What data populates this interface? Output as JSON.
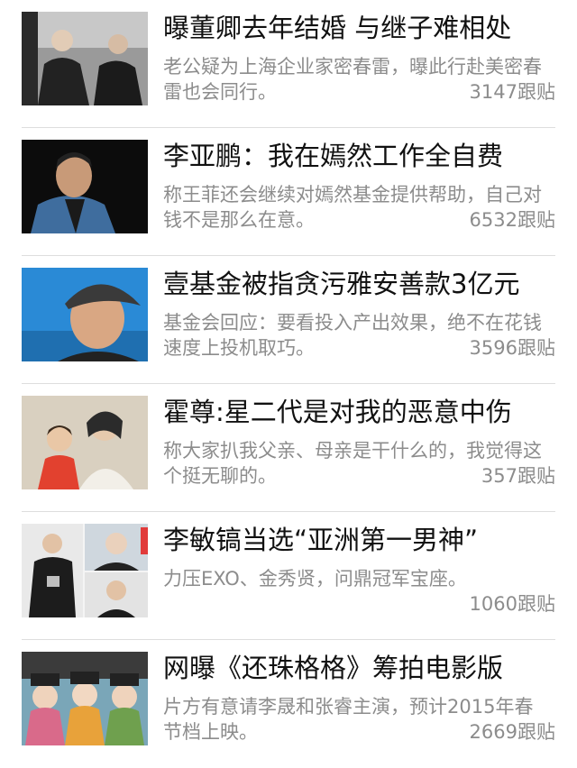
{
  "news": [
    {
      "title": "曝董卿去年结婚 与继子难相处",
      "summary": "老公疑为上海企业家密春雷，曝此行赴美密春雷也会同行。",
      "comments": "3147跟贴",
      "image_subject": "couple-walking-photo"
    },
    {
      "title": "李亚鹏：我在嫣然工作全自费",
      "summary": "称王菲还会继续对嫣然基金提供帮助，自己对钱不是那么在意。",
      "comments": "6532跟贴",
      "image_subject": "man-portrait-photo"
    },
    {
      "title": "壹基金被指贪污雅安善款3亿元",
      "summary": "基金会回应：要看投入产出效果，绝不在花钱速度上投机取巧。",
      "comments": "3596跟贴",
      "image_subject": "man-in-cap-photo"
    },
    {
      "title": "霍尊:星二代是对我的恶意中伤",
      "summary": "称大家扒我父亲、母亲是干什么的，我觉得这个挺无聊的。",
      "comments": "357跟贴",
      "image_subject": "mother-and-child-photo"
    },
    {
      "title": "李敏镐当选“亚洲第一男神”",
      "summary": "力压EXO、金秀贤，问鼎冠军宝座。",
      "comments": "1060跟贴",
      "image_subject": "collage-photo"
    },
    {
      "title": "网曝《还珠格格》筹拍电影版",
      "summary": "片方有意请李晟和张睿主演，预计2015年春节档上映。",
      "comments": "2669跟贴",
      "image_subject": "costume-drama-photo"
    }
  ]
}
